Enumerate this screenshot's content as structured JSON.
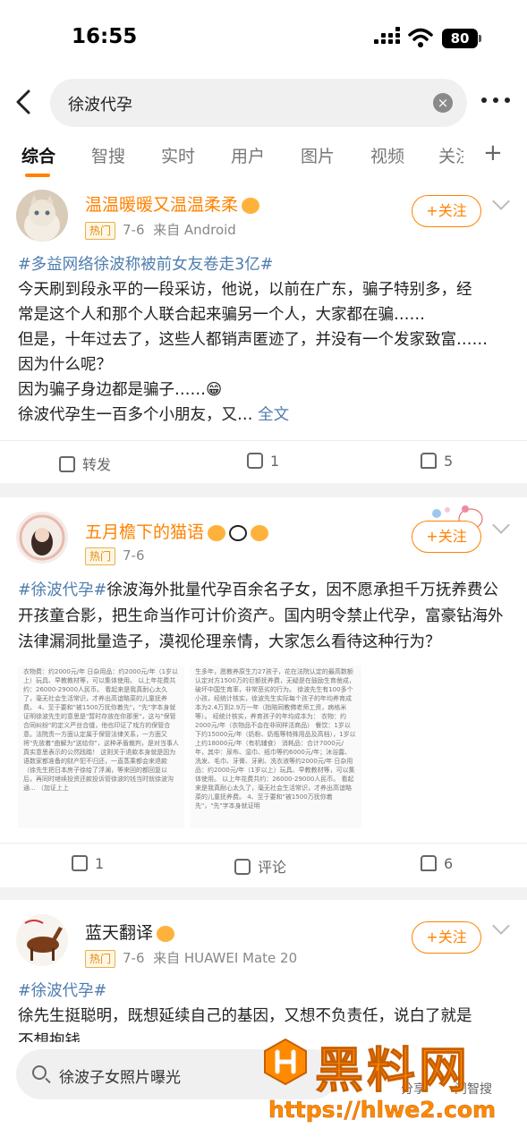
{
  "status_bar": {
    "time": "16:55",
    "battery": "80"
  },
  "search": {
    "query": "徐波代孕"
  },
  "tabs": [
    "综合",
    "智搜",
    "实时",
    "用户",
    "图片",
    "视频",
    "关注"
  ],
  "posts": [
    {
      "author": "温温暖暖又温温柔柔",
      "hot_badge": "热门",
      "date": "7-6",
      "source": "来自 Android",
      "follow_label": "+关注",
      "hashtag": "#多益网络徐波称被前女友卷走3亿#",
      "lines": [
        "今天刷到段永平的一段采访，他说，以前在广东，骗子特别多，经",
        "常是这个人和那个人联合起来骗另一个人，大家都在骗……",
        "但是，十年过去了，这些人都销声匿迹了，并没有一个发家致富……",
        "因为什么呢？",
        "因为骗子身边都是骗子……😁"
      ],
      "last_line": "徐波代孕生一百多个小朋友，又…",
      "full_text_link": "全文",
      "actions": {
        "repost": "转发",
        "comments": "1",
        "likes": "5"
      }
    },
    {
      "author": "五月檐下的猫语",
      "hot_badge": "热门",
      "date": "7-6",
      "follow_label": "+关注",
      "hashtag": "#徐波代孕#",
      "text": "徐波海外批量代孕百余名子女，因不愿承担千万抚养费公开孩童合影，把生命当作可计价资产。国内明令禁止代孕，富豪钻海外法律漏洞批量造子，漠视伦理亲情，大家怎么看待这种行为？",
      "doc_left": "衣物费：约2000元/年\n日杂用品：约2000元/年（1岁以上）玩具、早教教材等，可以集体使用。\n以上年花费共约：26000-29000人民币。\n看起来是我真耐心太久了，毫无社会生活常识，才养出高谊略菜的儿童抚养费。\n4、至于要和\"被1500万抚你着先\"，\"先\"字本身就证明徐波先生的意思是\"暂时存放在你那里\"，这与\"保管合同纠纷\"的定义严丝合缝，他也印证了戏方的保管合意。法院责一方面认定属于保管法律关系，一方面又将\"先放着\"曲解为\"送给你\"，这种矛盾裁判，是对当事人真实意思表示的公然践踏！\n这则关于退款本身就是因为语数家都准备的财产犯不归还，一直蒸乘都会来退款（徐先生把日本房子徐给了浮澜，等来回的都回复以后，再同时继续投资还款投诉管徐波的钱当时就徐波沟通...\n（加证上上",
      "doc_right": "生多年，愿教养原生力27孩子，花在法院认定的最高数额\n认定对方1500万的巨额抚养费，无疑是在鼓励生育凿成，破坏中国生育率，非常恶劣的行为。\n徐波先生有100多个小孩，经统计核实，徐波先生实际每个孩子的年均养育成本为2.4万到2.9万一年（指陪同教佛老师工资，病格米等）。\n经统计核实，养育孩子的年均成本为：\n衣物：约2000元/年（衣物品不会在非同样活商品）\n餐饮：1岁以下约15000元/年（奶粉、奶瓶等特殊用品及高档），1岁以上约18000元/年（有机辅食）\n消耗品：合计7000元/年，其中：尿布、湿巾、纸巾等约6000元/年；沐浴露、洗发、毛巾、牙膏、牙刷、洗衣液等约2000元/年\n日杂用品：约2000元/年（1岁以上）玩具、早教教材等，可以集体使用。\n以上年花费共约：26000-29000人民币。\n看起来是我真耐心太久了，毫无社会生活常识，才养出高谊略菜的儿童抚养费。\n4、至于要和\"被1500万抚你着先\"，\"先\"字本身就证明",
      "actions": {
        "repost": "1",
        "comments": "评论",
        "likes": "6"
      }
    },
    {
      "author": "蓝天翻译",
      "hot_badge": "热门",
      "date": "7-6",
      "source": "来自 HUAWEI Mate 20",
      "follow_label": "+关注",
      "hashtag": "#徐波代孕#",
      "lines": [
        "徐先生挺聪明，既想延续自己的基因，又想不负责任，说白了就是",
        "不想抱钱"
      ]
    }
  ],
  "bottom_search": {
    "query": "徐波子女照片曝光",
    "share_label": "分享",
    "hint": "问智搜"
  },
  "watermark": {
    "title": "黑料网",
    "url": "https://hlwe2.com"
  }
}
